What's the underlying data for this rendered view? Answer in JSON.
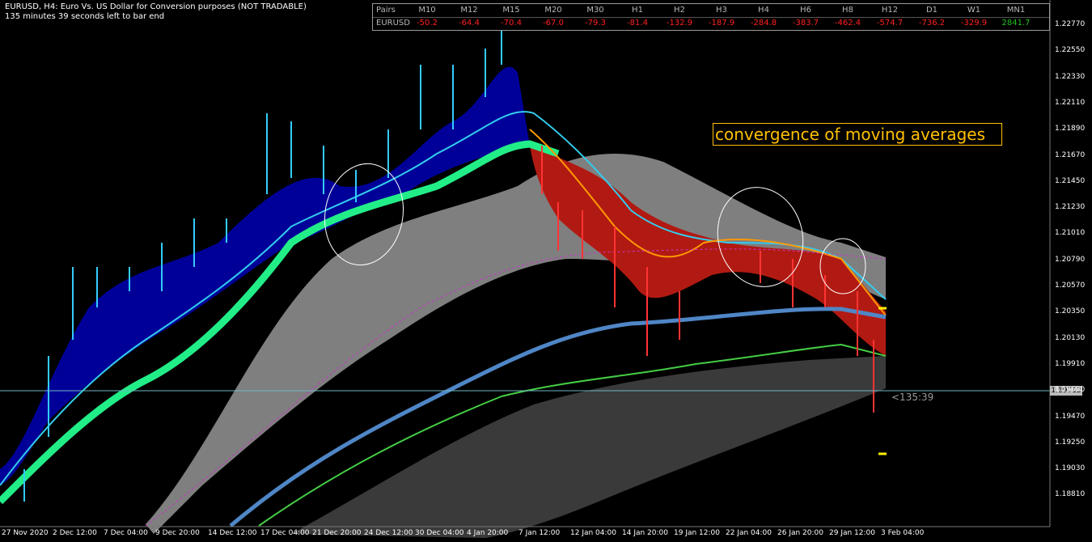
{
  "header": {
    "line1": "EURUSD, H4:  Euro Vs. US Dollar for Conversion purposes (NOT TRADABLE)",
    "line2": "135 minutes 39 seconds left to bar end"
  },
  "pairs_table": {
    "corner_label": "Pairs",
    "pair": "EURUSD",
    "timeframes": [
      "M10",
      "M12",
      "M15",
      "M20",
      "M30",
      "H1",
      "H2",
      "H3",
      "H4",
      "H6",
      "H8",
      "H12",
      "D1",
      "W1",
      "MN1"
    ],
    "values": [
      "-50.2",
      "-64.4",
      "-70.4",
      "-67.0",
      "-79.3",
      "-81.4",
      "-132.9",
      "-187.9",
      "-284.8",
      "-383.7",
      "-462.4",
      "-574.7",
      "-736.2",
      "-329.9",
      "2841.7"
    ],
    "value_colors": [
      "#ff2020",
      "#ff2020",
      "#ff2020",
      "#ff2020",
      "#ff2020",
      "#ff2020",
      "#ff2020",
      "#ff2020",
      "#ff2020",
      "#ff2020",
      "#ff2020",
      "#ff2020",
      "#ff2020",
      "#ff2020",
      "#20c020"
    ],
    "overlap_text": "-10.5"
  },
  "annotation": {
    "text": "convergence of moving averages",
    "color": "#ffc000"
  },
  "price_axis": {
    "ticks": [
      "1.22770",
      "1.22550",
      "1.22330",
      "1.22110",
      "1.21890",
      "1.21670",
      "1.21450",
      "1.21230",
      "1.21010",
      "1.20790",
      "1.20570",
      "1.20350",
      "1.20130",
      "1.19910",
      "1.19690",
      "1.19470",
      "1.19250",
      "1.19030",
      "1.18810"
    ],
    "current_price": "1.19712"
  },
  "time_axis": {
    "ticks": [
      "27 Nov 2020",
      "2 Dec 12:00",
      "7 Dec 04:00",
      "9 Dec 20:00",
      "14 Dec 12:00",
      "17 Dec 04:00",
      "21 Dec 20:00",
      "24 Dec 12:00",
      "30 Dec 04:00",
      "4 Jan 20:00",
      "7 Jan 12:00",
      "12 Jan 04:00",
      "14 Jan 20:00",
      "19 Jan 12:00",
      "22 Jan 04:00",
      "26 Jan 20:00",
      "29 Jan 12:00",
      "3 Feb 04:00"
    ]
  },
  "countdown": "<135:39",
  "colors": {
    "background": "#000000",
    "bull_band": "#000099",
    "bear_band": "#b11a12",
    "cloud": "#808080",
    "ma_green": "#22ee88",
    "ma_cyan": "#33ccee",
    "ma_steelblue": "#4f86c6",
    "ma_lime": "#44cc44",
    "ma_orange": "#ff9900",
    "ma_magenta": "#cc33cc"
  }
}
